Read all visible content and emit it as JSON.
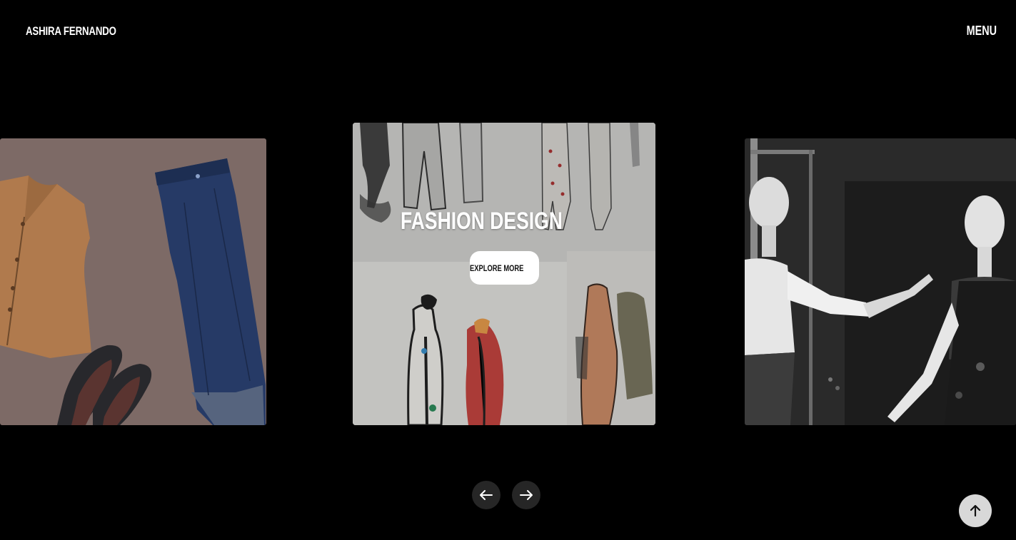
{
  "header": {
    "brand": "ASHIRA FERNANDO",
    "menu_label": "MENU"
  },
  "carousel": {
    "slides": [
      {
        "image": "flat-lay-clothing-illustration"
      },
      {
        "image": "fashion-sketches-board",
        "title": "FASHION DESIGN",
        "button_label": "EXPLORE MORE"
      },
      {
        "image": "mannequins-black-and-white"
      }
    ],
    "prev_icon": "arrow-left-icon",
    "next_icon": "arrow-right-icon"
  },
  "back_to_top_icon": "arrow-up-icon",
  "colors": {
    "background": "#000000",
    "nav_button": "#262626",
    "back_to_top": "#d8d8d8",
    "explore_button": "#ffffff"
  }
}
